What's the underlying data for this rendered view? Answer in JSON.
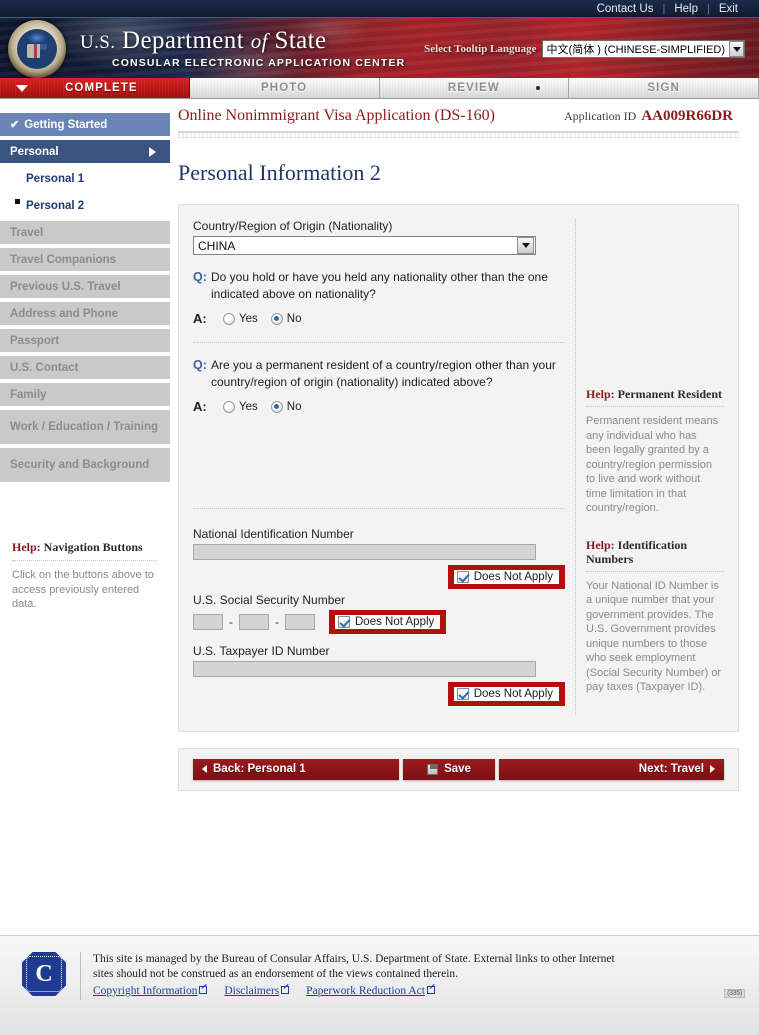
{
  "topbar": {
    "links": [
      {
        "label": "Contact Us"
      },
      {
        "label": "Help"
      },
      {
        "label": "Exit"
      }
    ],
    "separator": "|"
  },
  "banner": {
    "title_us": "U.S.",
    "title_dept": "Department",
    "title_of": "of",
    "title_state": "State",
    "subtitle": "CONSULAR ELECTRONIC APPLICATION CENTER",
    "seal_icon": "us-department-of-state-seal",
    "language": {
      "label": "Select Tooltip Language",
      "value": "中文(简体 ) (CHINESE-SIMPLIFIED)",
      "caret_icon": "chevron-down-icon"
    }
  },
  "tabs": [
    {
      "label": "COMPLETE",
      "state": "active",
      "marker": "triangle-down-icon"
    },
    {
      "label": "PHOTO",
      "state": "inactive",
      "marker": ""
    },
    {
      "label": "REVIEW",
      "state": "inactive",
      "marker": "dot-icon"
    },
    {
      "label": "SIGN",
      "state": "inactive",
      "marker": ""
    }
  ],
  "sidebar": {
    "items": [
      {
        "label": "Getting Started",
        "state": "done",
        "icon": "check-icon"
      },
      {
        "label": "Personal",
        "state": "current",
        "icon": "chevron-right-icon"
      },
      {
        "label": "Personal 1",
        "state": "sub"
      },
      {
        "label": "Personal 2",
        "state": "sub-current",
        "icon": "square-bullet-icon"
      },
      {
        "label": "Travel",
        "state": "disabled"
      },
      {
        "label": "Travel Companions",
        "state": "disabled"
      },
      {
        "label": "Previous U.S. Travel",
        "state": "disabled"
      },
      {
        "label": "Address and Phone",
        "state": "disabled"
      },
      {
        "label": "Passport",
        "state": "disabled"
      },
      {
        "label": "U.S. Contact",
        "state": "disabled"
      },
      {
        "label": "Family",
        "state": "disabled"
      },
      {
        "label": "Work / Education / Training",
        "state": "disabled"
      },
      {
        "label": "Security and Background",
        "state": "disabled"
      }
    ],
    "help": {
      "title_prefix": "Help:",
      "title_rest": " Navigation Buttons",
      "body": "Click on the buttons above to access previously entered data."
    }
  },
  "app_header": {
    "app_title": "Online Nonimmigrant Visa Application (DS-160)",
    "app_id_label": "Application ID",
    "app_id_value": "AA009R66DR"
  },
  "page_title": "Personal Information 2",
  "form": {
    "nationality": {
      "label": "Country/Region of Origin (Nationality)",
      "value": "CHINA",
      "caret_icon": "chevron-down-icon"
    },
    "questions": [
      {
        "q_marker": "Q:",
        "a_marker": "A:",
        "question": "Do you hold or have you held any nationality other than the one indicated above on nationality?",
        "options": [
          {
            "label": "Yes",
            "selected": false
          },
          {
            "label": "No",
            "selected": true
          }
        ]
      },
      {
        "q_marker": "Q:",
        "a_marker": "A:",
        "question": "Are you a permanent resident of a country/region other than your country/region of origin (nationality) indicated above?",
        "options": [
          {
            "label": "Yes",
            "selected": false
          },
          {
            "label": "No",
            "selected": true
          }
        ]
      }
    ],
    "identification": {
      "national_id": {
        "label": "National Identification Number",
        "value": "",
        "does_not_apply_label": "Does Not Apply",
        "does_not_apply_checked": true
      },
      "ssn": {
        "label": "U.S. Social Security Number",
        "parts": [
          "",
          "",
          ""
        ],
        "dash": "-",
        "does_not_apply_label": "Does Not Apply",
        "does_not_apply_checked": true
      },
      "taxpayer_id": {
        "label": "U.S. Taxpayer ID Number",
        "value": "",
        "does_not_apply_label": "Does Not Apply",
        "does_not_apply_checked": true
      }
    }
  },
  "help_cards": [
    {
      "title_prefix": "Help:",
      "title_rest": " Permanent Resident",
      "body": "Permanent resident means any individual who has been legally granted by a country/region permission to live and work without time limitation in that country/region."
    },
    {
      "title_prefix": "Help:",
      "title_rest": " Identification Numbers",
      "body": "Your National ID Number is a unique number that your government provides. The U.S. Government provides unique numbers to those who seek employment (Social Security Number) or pay taxes (Taxpayer ID)."
    }
  ],
  "nav_buttons": {
    "back_label": "Back: Personal 1",
    "back_icon": "triangle-left-icon",
    "save_label": "Save",
    "save_icon": "floppy-disk-icon",
    "next_label": "Next: Travel",
    "next_icon": "triangle-right-icon"
  },
  "footer": {
    "seal_icon": "consular-affairs-c-seal",
    "seal_letter": "C",
    "text_line1": "This site is managed by the Bureau of Consular Affairs, U.S. Department of State. External links to other Internet",
    "text_line2": "sites should not be construed as an endorsement of the views contained therein.",
    "links": [
      {
        "label": "Copyright Information",
        "icon": "external-link-icon"
      },
      {
        "label": "Disclaimers",
        "icon": "external-link-icon"
      },
      {
        "label": "Paperwork Reduction Act",
        "icon": "external-link-icon"
      }
    ],
    "version_code": "(335)"
  },
  "colors": {
    "brand_red": "#8c1b1b",
    "tab_active_red": "#c01514",
    "nav_current_blue": "#3b547f",
    "nav_done_blue": "#6a85b5",
    "title_blue": "#22356b",
    "highlight_red": "#b40f0f"
  }
}
